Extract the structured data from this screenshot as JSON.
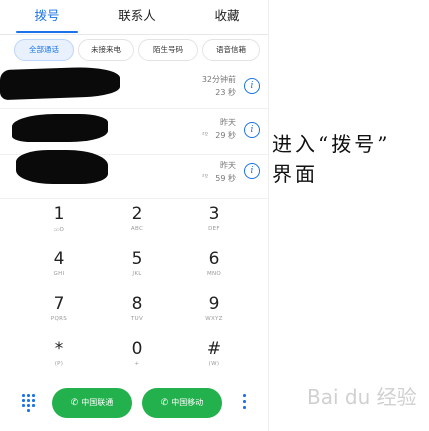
{
  "tabs": [
    {
      "label": "拨号",
      "active": true
    },
    {
      "label": "联系人",
      "active": false
    },
    {
      "label": "收藏",
      "active": false
    }
  ],
  "filters": [
    {
      "label": "全部通话",
      "active": true
    },
    {
      "label": "未接来电",
      "active": false
    },
    {
      "label": "陌生号码",
      "active": false
    },
    {
      "label": "语音信箱",
      "active": false
    }
  ],
  "calls": [
    {
      "time": "32分钟前",
      "duration": "23 秒"
    },
    {
      "time": "昨天",
      "duration": "29 秒"
    },
    {
      "time": "昨天",
      "duration": "59 秒"
    }
  ],
  "keypad": [
    {
      "digit": "1",
      "letters": "ထO"
    },
    {
      "digit": "2",
      "letters": "ABC"
    },
    {
      "digit": "3",
      "letters": "DEF"
    },
    {
      "digit": "4",
      "letters": "GHI"
    },
    {
      "digit": "5",
      "letters": "JKL"
    },
    {
      "digit": "6",
      "letters": "MNO"
    },
    {
      "digit": "7",
      "letters": "PQRS"
    },
    {
      "digit": "8",
      "letters": "TUV"
    },
    {
      "digit": "9",
      "letters": "WXYZ"
    },
    {
      "digit": "*",
      "letters": "(P)"
    },
    {
      "digit": "0",
      "letters": "+"
    },
    {
      "digit": "#",
      "letters": "(W)"
    }
  ],
  "call_buttons": [
    {
      "label": "中国联通"
    },
    {
      "label": "中国移动"
    }
  ],
  "annotation": {
    "line1": "进入“拨号”",
    "line2": "界面"
  },
  "colors": {
    "accent": "#1a73e8",
    "call_green": "#23b14d"
  },
  "icons": {
    "info": "info-icon",
    "dialpad": "dialpad-grid-icon",
    "call": "phone-icon",
    "more": "more-vertical-icon"
  }
}
